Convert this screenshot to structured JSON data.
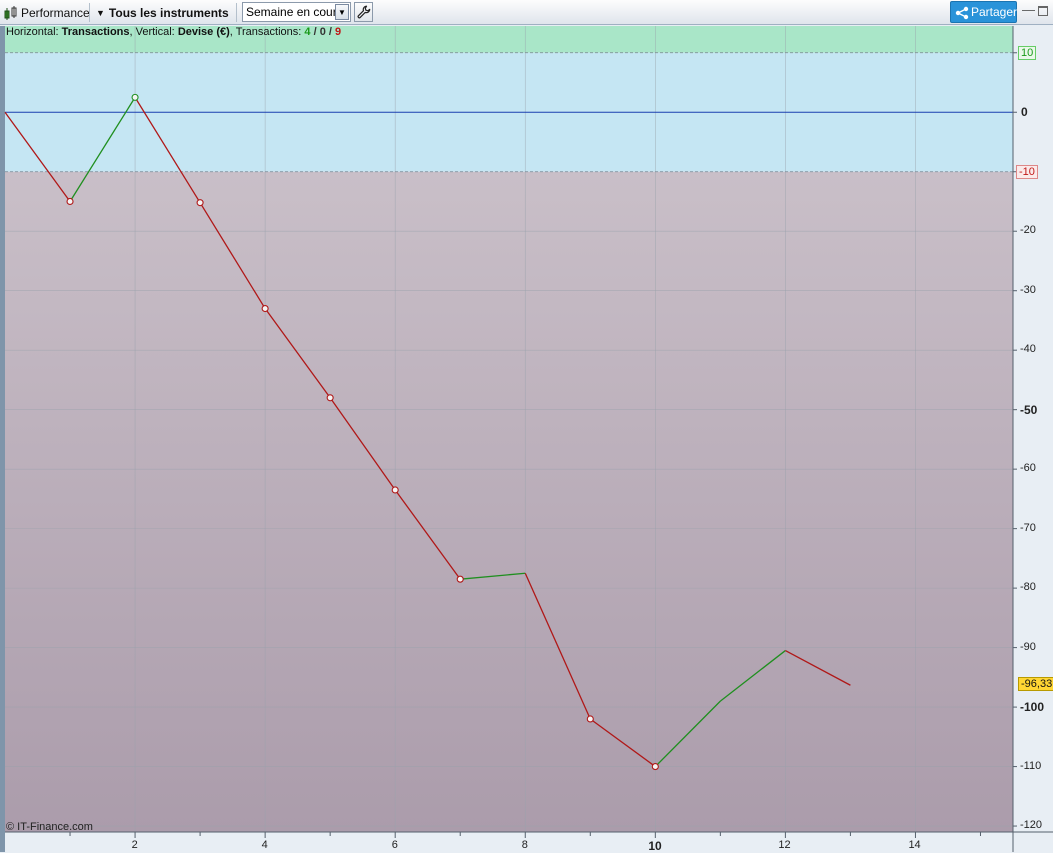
{
  "toolbar": {
    "performance_label": "Performance",
    "instruments_label": "Tous les instruments",
    "period_value": "Semaine en cours",
    "share_label": "Partager"
  },
  "info": {
    "horizontal_prefix": "Horizontal:",
    "horizontal_value": "Transactions",
    "vertical_prefix": ", Vertical:",
    "vertical_value": "Devise (€)",
    "transactions_prefix": ", Transactions:",
    "winners": "4",
    "neutral": "0",
    "losers": "9",
    "sep": "/"
  },
  "credit": "© IT-Finance.com",
  "colors": {
    "gain_line": "#1f8f1f",
    "loss_line": "#b01818",
    "zero_line": "#1a3fb0",
    "upper_band": "#a9e6c8",
    "mid_band": "#c5e6f3",
    "lower_band_top": "#c9bfc8",
    "lower_band_bottom": "#ab9cab",
    "last_value_badge": "#ffd633"
  },
  "chart_data": {
    "type": "line",
    "x": [
      0,
      1,
      2,
      3,
      4,
      5,
      6,
      7,
      8,
      9,
      10,
      11,
      12,
      13
    ],
    "y": [
      0,
      -15,
      2.5,
      -15.2,
      -33,
      -48,
      -63.5,
      -78.5,
      -77.5,
      -102,
      -110,
      -99,
      -90.5,
      -96.33
    ],
    "markers": [
      1,
      2,
      3,
      4,
      5,
      6,
      7,
      9,
      10
    ],
    "xlim": [
      0,
      15.5
    ],
    "ylim": [
      -121,
      14.5
    ],
    "x_ticks": [
      "2",
      "4",
      "6",
      "8",
      "10",
      "12",
      "14"
    ],
    "x_tick_values": [
      2,
      4,
      6,
      8,
      10,
      12,
      14
    ],
    "x_bold_tick": "10",
    "y_ticks": [
      "10",
      "0",
      "-10",
      "-20",
      "-30",
      "-40",
      "-50",
      "-60",
      "-70",
      "-80",
      "-90",
      "-100",
      "-110",
      "-120"
    ],
    "y_tick_values": [
      10,
      0,
      -10,
      -20,
      -30,
      -40,
      -50,
      -60,
      -70,
      -80,
      -90,
      -100,
      -110,
      -120
    ],
    "y_bold_ticks": [
      "0",
      "-50",
      "-100"
    ],
    "threshold_upper": 10,
    "threshold_lower": -10,
    "last_value_label": "-96,33",
    "last_value": -96.33,
    "grid": true
  }
}
